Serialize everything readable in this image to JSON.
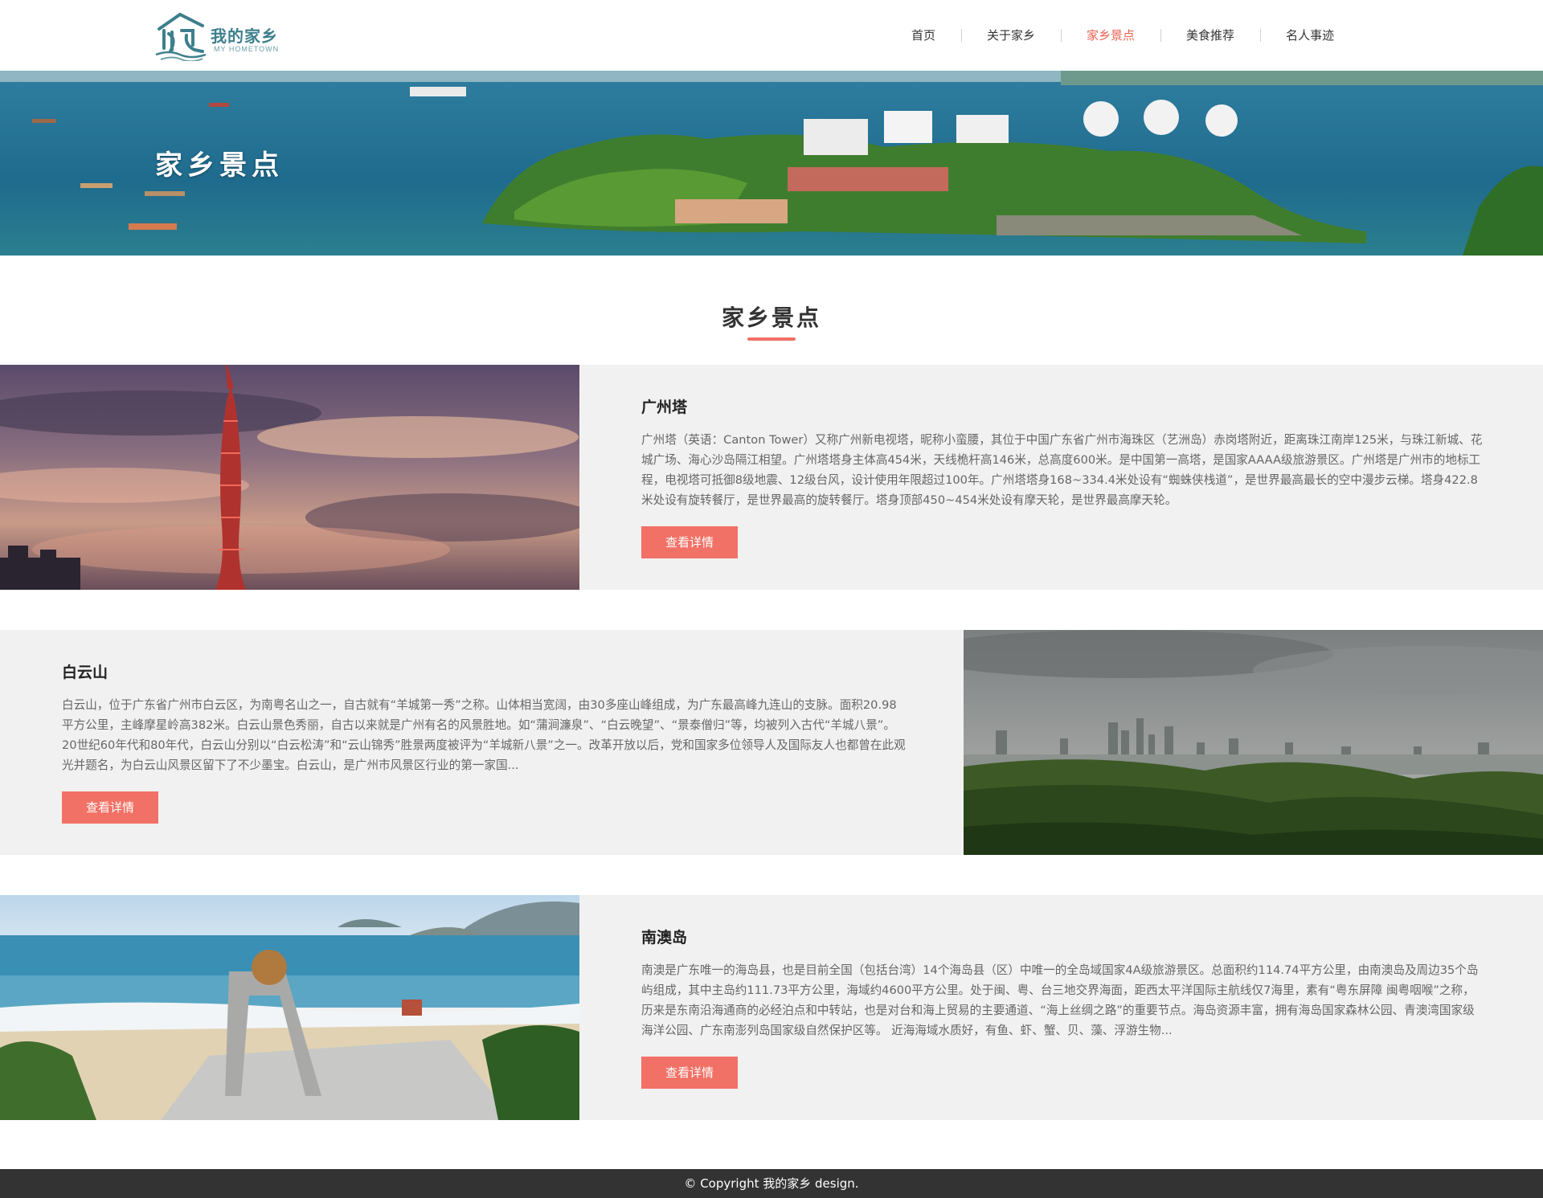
{
  "header": {
    "logo_text": "我的家乡",
    "logo_sub": "MY HOMETOWN",
    "nav": [
      {
        "label": "首页"
      },
      {
        "label": "关于家乡"
      },
      {
        "label": "家乡景点"
      },
      {
        "label": "美食推荐"
      },
      {
        "label": "名人事迹"
      }
    ],
    "active_index": 2
  },
  "banner": {
    "title": "家乡景点"
  },
  "section": {
    "title": "家乡景点"
  },
  "items": [
    {
      "title": "广州塔",
      "desc": "广州塔（英语：Canton Tower）又称广州新电视塔，昵称小蛮腰，其位于中国广东省广州市海珠区（艺洲岛）赤岗塔附近，距离珠江南岸125米，与珠江新城、花城广场、海心沙岛隔江相望。广州塔塔身主体高454米，天线桅杆高146米，总高度600米。是中国第一高塔，是国家AAAA级旅游景区。广州塔是广州市的地标工程，电视塔可抵御8级地震、12级台风，设计使用年限超过100年。广州塔塔身168~334.4米处设有“蜘蛛侠栈道”，是世界最高最长的空中漫步云梯。塔身422.8米处设有旋转餐厅，是世界最高的旋转餐厅。塔身顶部450~454米处设有摩天轮，是世界最高摩天轮。",
      "button": "查看详情"
    },
    {
      "title": "白云山",
      "desc": "白云山，位于广东省广州市白云区，为南粤名山之一，自古就有“羊城第一秀”之称。山体相当宽阔，由30多座山峰组成，为广东最高峰九连山的支脉。面积20.98平方公里，主峰摩星岭高382米。白云山景色秀丽，自古以来就是广州有名的风景胜地。如“蒲涧濂泉”、“白云晚望”、“景泰僧归”等，均被列入古代“羊城八景”。20世纪60年代和80年代，白云山分别以“白云松涛”和“云山锦秀”胜景两度被评为“羊城新八景”之一。改革开放以后，党和国家多位领导人及国际友人也都曾在此观光并题名，为白云山风景区留下了不少墨宝。白云山，是广州市风景区行业的第一家国...",
      "button": "查看详情"
    },
    {
      "title": "南澳岛",
      "desc": "南澳是广东唯一的海岛县，也是目前全国（包括台湾）14个海岛县（区）中唯一的全岛域国家4A级旅游景区。总面积约114.74平方公里，由南澳岛及周边35个岛屿组成，其中主岛约111.73平方公里，海域约4600平方公里。处于闽、粤、台三地交界海面，距西太平洋国际主航线仅7海里，素有“粤东屏障 闽粤咽喉”之称，历来是东南沿海通商的必经泊点和中转站，也是对台和海上贸易的主要通道、“海上丝绸之路”的重要节点。海岛资源丰富，拥有海岛国家森林公园、青澳湾国家级海洋公园、广东南澎列岛国家级自然保护区等。 近海海域水质好，有鱼、虾、蟹、贝、藻、浮游生物...",
      "button": "查看详情"
    }
  ],
  "footer": {
    "text": "©  Copyright  我的家乡  design."
  },
  "colors": {
    "accent": "#f27166",
    "nav_active": "#e8614f",
    "footer_bg": "#333333",
    "row_bg": "#f1f1f1",
    "logo": "#3d7f8c"
  }
}
